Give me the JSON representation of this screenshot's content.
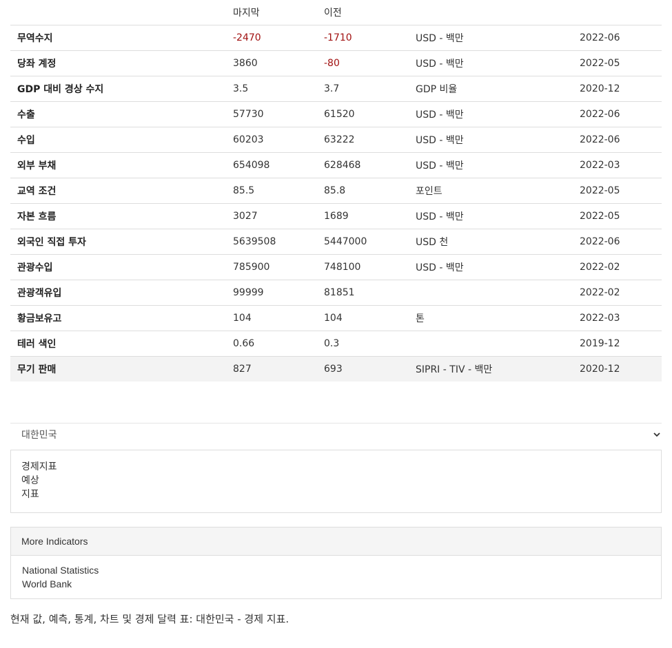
{
  "table": {
    "headers": [
      "",
      "마지막",
      "이전",
      "",
      ""
    ],
    "rows": [
      {
        "name": "무역수지",
        "last": "-2470",
        "prev": "-1710",
        "unit": "USD - 백만",
        "date": "2022-06"
      },
      {
        "name": "당좌 계정",
        "last": "3860",
        "prev": "-80",
        "unit": "USD - 백만",
        "date": "2022-05"
      },
      {
        "name": "GDP 대비 경상 수지",
        "last": "3.5",
        "prev": "3.7",
        "unit": "GDP 비율",
        "date": "2020-12"
      },
      {
        "name": "수출",
        "last": "57730",
        "prev": "61520",
        "unit": "USD - 백만",
        "date": "2022-06"
      },
      {
        "name": "수입",
        "last": "60203",
        "prev": "63222",
        "unit": "USD - 백만",
        "date": "2022-06"
      },
      {
        "name": "외부 부채",
        "last": "654098",
        "prev": "628468",
        "unit": "USD - 백만",
        "date": "2022-03"
      },
      {
        "name": "교역 조건",
        "last": "85.5",
        "prev": "85.8",
        "unit": "포인트",
        "date": "2022-05"
      },
      {
        "name": "자본 흐름",
        "last": "3027",
        "prev": "1689",
        "unit": "USD - 백만",
        "date": "2022-05"
      },
      {
        "name": "외국인 직접 투자",
        "last": "5639508",
        "prev": "5447000",
        "unit": "USD 천",
        "date": "2022-06"
      },
      {
        "name": "관광수입",
        "last": "785900",
        "prev": "748100",
        "unit": "USD - 백만",
        "date": "2022-02"
      },
      {
        "name": "관광객유입",
        "last": "99999",
        "prev": "81851",
        "unit": "",
        "date": "2022-02"
      },
      {
        "name": "황금보유고",
        "last": "104",
        "prev": "104",
        "unit": "톤",
        "date": "2022-03"
      },
      {
        "name": "테러 색인",
        "last": "0.66",
        "prev": "0.3",
        "unit": "",
        "date": "2019-12"
      },
      {
        "name": "무기 판매",
        "last": "827",
        "prev": "693",
        "unit": "SIPRI - TIV - 백만",
        "date": "2020-12"
      }
    ]
  },
  "country_select": {
    "value": "대한민국",
    "icon": "chevron-down-icon"
  },
  "links_panel": {
    "items": [
      "경제지표",
      "예상",
      "지표"
    ]
  },
  "more_indicators": {
    "title": "More Indicators",
    "items": [
      "National Statistics",
      "World Bank"
    ]
  },
  "footer": {
    "text": "현재 값, 예측, 통계, 차트 및 경제 달력 표: 대한민국 - 경제 지표."
  },
  "colors": {
    "negative": "#a11111",
    "highlight_row": "#f3f3f3",
    "border": "#dddddd"
  }
}
